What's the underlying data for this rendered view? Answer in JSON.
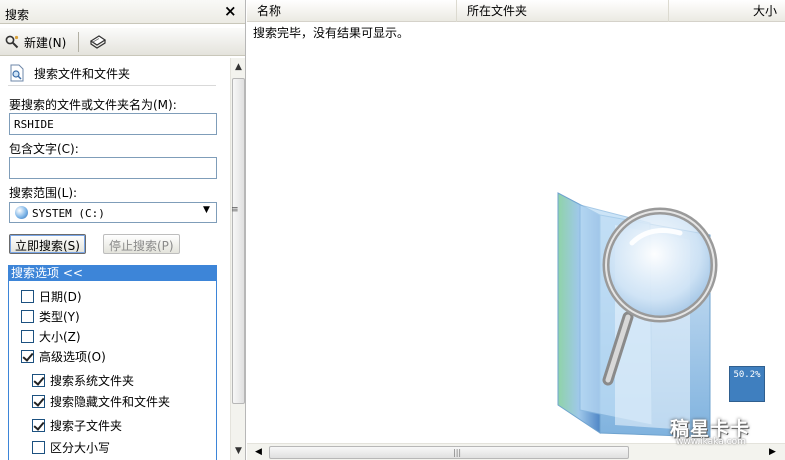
{
  "panel": {
    "title": "搜索",
    "close_glyph": "×"
  },
  "toolbar": {
    "new_label": "新建(N)"
  },
  "section": {
    "title": "搜索文件和文件夹"
  },
  "form": {
    "name_label": "要搜索的文件或文件夹名为(M):",
    "name_value": "RSHIDE",
    "text_label": "包含文字(C):",
    "text_value": "",
    "scope_label": "搜索范围(L):",
    "scope_value": "SYSTEM (C:)",
    "search_now": "立即搜索(S)",
    "stop_search": "停止搜索(P)"
  },
  "options": {
    "header": "搜索选项 <<",
    "items": [
      {
        "label": "日期(D)",
        "checked": false
      },
      {
        "label": "类型(Y)",
        "checked": false
      },
      {
        "label": "大小(Z)",
        "checked": false
      },
      {
        "label": "高级选项(O)",
        "checked": true
      }
    ],
    "advanced": [
      {
        "label": "搜索系统文件夹",
        "checked": true
      },
      {
        "label": "搜索隐藏文件和文件夹",
        "checked": true
      },
      {
        "label": "搜索子文件夹",
        "checked": true
      },
      {
        "label": "区分大小写",
        "checked": false
      }
    ]
  },
  "results": {
    "columns": [
      "名称",
      "所在文件夹",
      "大小"
    ],
    "message": "搜索完毕，没有结果可显示。"
  },
  "overlay": {
    "percent": "50.2%",
    "watermark": "稿星卡卡",
    "watermark_url": "www.ikaka.com"
  },
  "icons": [
    "search-person-icon",
    "book-icon",
    "document-search-icon",
    "drive-icon",
    "folder-magnifier-icon"
  ],
  "colors": {
    "options_header": "#3d85d8",
    "field_border": "#7f9db9",
    "percent_box": "#3f7fbf"
  }
}
